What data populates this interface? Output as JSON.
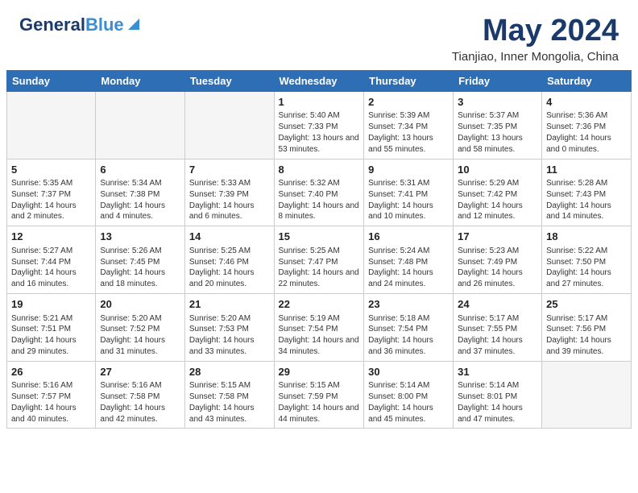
{
  "header": {
    "logo_general": "General",
    "logo_blue": "Blue",
    "month_year": "May 2024",
    "location": "Tianjiao, Inner Mongolia, China"
  },
  "weekdays": [
    "Sunday",
    "Monday",
    "Tuesday",
    "Wednesday",
    "Thursday",
    "Friday",
    "Saturday"
  ],
  "rows": [
    [
      {
        "day": "",
        "sunrise": "",
        "sunset": "",
        "daylight": ""
      },
      {
        "day": "",
        "sunrise": "",
        "sunset": "",
        "daylight": ""
      },
      {
        "day": "",
        "sunrise": "",
        "sunset": "",
        "daylight": ""
      },
      {
        "day": "1",
        "sunrise": "Sunrise: 5:40 AM",
        "sunset": "Sunset: 7:33 PM",
        "daylight": "Daylight: 13 hours and 53 minutes."
      },
      {
        "day": "2",
        "sunrise": "Sunrise: 5:39 AM",
        "sunset": "Sunset: 7:34 PM",
        "daylight": "Daylight: 13 hours and 55 minutes."
      },
      {
        "day": "3",
        "sunrise": "Sunrise: 5:37 AM",
        "sunset": "Sunset: 7:35 PM",
        "daylight": "Daylight: 13 hours and 58 minutes."
      },
      {
        "day": "4",
        "sunrise": "Sunrise: 5:36 AM",
        "sunset": "Sunset: 7:36 PM",
        "daylight": "Daylight: 14 hours and 0 minutes."
      }
    ],
    [
      {
        "day": "5",
        "sunrise": "Sunrise: 5:35 AM",
        "sunset": "Sunset: 7:37 PM",
        "daylight": "Daylight: 14 hours and 2 minutes."
      },
      {
        "day": "6",
        "sunrise": "Sunrise: 5:34 AM",
        "sunset": "Sunset: 7:38 PM",
        "daylight": "Daylight: 14 hours and 4 minutes."
      },
      {
        "day": "7",
        "sunrise": "Sunrise: 5:33 AM",
        "sunset": "Sunset: 7:39 PM",
        "daylight": "Daylight: 14 hours and 6 minutes."
      },
      {
        "day": "8",
        "sunrise": "Sunrise: 5:32 AM",
        "sunset": "Sunset: 7:40 PM",
        "daylight": "Daylight: 14 hours and 8 minutes."
      },
      {
        "day": "9",
        "sunrise": "Sunrise: 5:31 AM",
        "sunset": "Sunset: 7:41 PM",
        "daylight": "Daylight: 14 hours and 10 minutes."
      },
      {
        "day": "10",
        "sunrise": "Sunrise: 5:29 AM",
        "sunset": "Sunset: 7:42 PM",
        "daylight": "Daylight: 14 hours and 12 minutes."
      },
      {
        "day": "11",
        "sunrise": "Sunrise: 5:28 AM",
        "sunset": "Sunset: 7:43 PM",
        "daylight": "Daylight: 14 hours and 14 minutes."
      }
    ],
    [
      {
        "day": "12",
        "sunrise": "Sunrise: 5:27 AM",
        "sunset": "Sunset: 7:44 PM",
        "daylight": "Daylight: 14 hours and 16 minutes."
      },
      {
        "day": "13",
        "sunrise": "Sunrise: 5:26 AM",
        "sunset": "Sunset: 7:45 PM",
        "daylight": "Daylight: 14 hours and 18 minutes."
      },
      {
        "day": "14",
        "sunrise": "Sunrise: 5:25 AM",
        "sunset": "Sunset: 7:46 PM",
        "daylight": "Daylight: 14 hours and 20 minutes."
      },
      {
        "day": "15",
        "sunrise": "Sunrise: 5:25 AM",
        "sunset": "Sunset: 7:47 PM",
        "daylight": "Daylight: 14 hours and 22 minutes."
      },
      {
        "day": "16",
        "sunrise": "Sunrise: 5:24 AM",
        "sunset": "Sunset: 7:48 PM",
        "daylight": "Daylight: 14 hours and 24 minutes."
      },
      {
        "day": "17",
        "sunrise": "Sunrise: 5:23 AM",
        "sunset": "Sunset: 7:49 PM",
        "daylight": "Daylight: 14 hours and 26 minutes."
      },
      {
        "day": "18",
        "sunrise": "Sunrise: 5:22 AM",
        "sunset": "Sunset: 7:50 PM",
        "daylight": "Daylight: 14 hours and 27 minutes."
      }
    ],
    [
      {
        "day": "19",
        "sunrise": "Sunrise: 5:21 AM",
        "sunset": "Sunset: 7:51 PM",
        "daylight": "Daylight: 14 hours and 29 minutes."
      },
      {
        "day": "20",
        "sunrise": "Sunrise: 5:20 AM",
        "sunset": "Sunset: 7:52 PM",
        "daylight": "Daylight: 14 hours and 31 minutes."
      },
      {
        "day": "21",
        "sunrise": "Sunrise: 5:20 AM",
        "sunset": "Sunset: 7:53 PM",
        "daylight": "Daylight: 14 hours and 33 minutes."
      },
      {
        "day": "22",
        "sunrise": "Sunrise: 5:19 AM",
        "sunset": "Sunset: 7:54 PM",
        "daylight": "Daylight: 14 hours and 34 minutes."
      },
      {
        "day": "23",
        "sunrise": "Sunrise: 5:18 AM",
        "sunset": "Sunset: 7:54 PM",
        "daylight": "Daylight: 14 hours and 36 minutes."
      },
      {
        "day": "24",
        "sunrise": "Sunrise: 5:17 AM",
        "sunset": "Sunset: 7:55 PM",
        "daylight": "Daylight: 14 hours and 37 minutes."
      },
      {
        "day": "25",
        "sunrise": "Sunrise: 5:17 AM",
        "sunset": "Sunset: 7:56 PM",
        "daylight": "Daylight: 14 hours and 39 minutes."
      }
    ],
    [
      {
        "day": "26",
        "sunrise": "Sunrise: 5:16 AM",
        "sunset": "Sunset: 7:57 PM",
        "daylight": "Daylight: 14 hours and 40 minutes."
      },
      {
        "day": "27",
        "sunrise": "Sunrise: 5:16 AM",
        "sunset": "Sunset: 7:58 PM",
        "daylight": "Daylight: 14 hours and 42 minutes."
      },
      {
        "day": "28",
        "sunrise": "Sunrise: 5:15 AM",
        "sunset": "Sunset: 7:58 PM",
        "daylight": "Daylight: 14 hours and 43 minutes."
      },
      {
        "day": "29",
        "sunrise": "Sunrise: 5:15 AM",
        "sunset": "Sunset: 7:59 PM",
        "daylight": "Daylight: 14 hours and 44 minutes."
      },
      {
        "day": "30",
        "sunrise": "Sunrise: 5:14 AM",
        "sunset": "Sunset: 8:00 PM",
        "daylight": "Daylight: 14 hours and 45 minutes."
      },
      {
        "day": "31",
        "sunrise": "Sunrise: 5:14 AM",
        "sunset": "Sunset: 8:01 PM",
        "daylight": "Daylight: 14 hours and 47 minutes."
      },
      {
        "day": "",
        "sunrise": "",
        "sunset": "",
        "daylight": ""
      }
    ]
  ]
}
